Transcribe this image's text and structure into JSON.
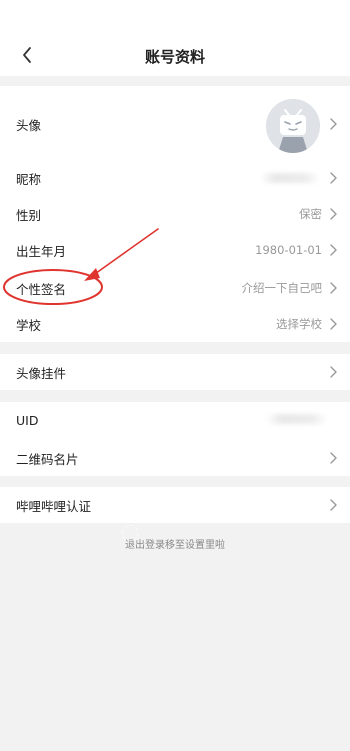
{
  "header": {
    "title": "账号资料"
  },
  "profile": {
    "avatar": {
      "label": "头像"
    },
    "nickname": {
      "label": "昵称",
      "value": ""
    },
    "gender": {
      "label": "性别",
      "value": "保密"
    },
    "birthday": {
      "label": "出生年月",
      "value": "1980-01-01"
    },
    "signature": {
      "label": "个性签名",
      "value": "介绍一下自己吧"
    },
    "school": {
      "label": "学校",
      "value": "选择学校"
    }
  },
  "pendant": {
    "label": "头像挂件"
  },
  "account": {
    "uid": {
      "label": "UID",
      "value": ""
    },
    "qrcode": {
      "label": "二维码名片"
    }
  },
  "certification": {
    "label": "哔哩哔哩认证"
  },
  "footer": {
    "note": "退出登录移至设置里啦"
  },
  "annotation": {
    "color": "#e0342f"
  },
  "icons": {
    "back": "back-arrow-icon",
    "chevron": "chevron-right-icon",
    "avatar": "bilibili-tv-avatar-icon"
  },
  "colors": {
    "background": "#f2f2f2",
    "row": "#ffffff",
    "muted_text": "#999999"
  }
}
